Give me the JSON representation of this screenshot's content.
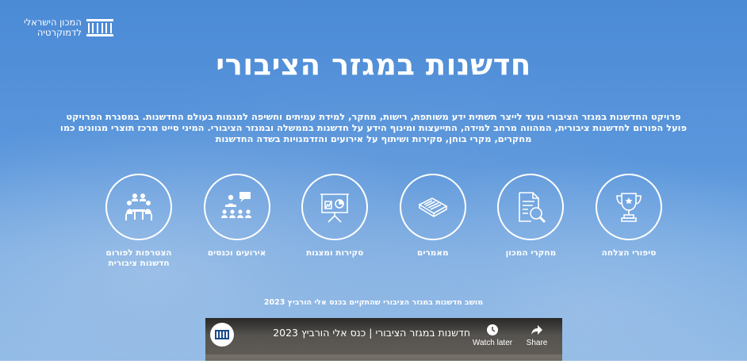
{
  "header": {
    "logo_line1": "המכון הישראלי",
    "logo_line2": "לדמוקרטיה"
  },
  "hero": {
    "title": "חדשנות במגזר הציבורי",
    "intro_line1": "פרויקט החדשנות במגזר הציבורי נועד לייצר תשתית ידע משותפת, רישות, מחקר, למידת עמיתים וחשיפה למגמות בעולם החדשנות. במסגרת הפרויקט",
    "intro_line2": "פועל הפורום לחדשנות ציבורית, המהווה מרחב למידה, התייעצות ומינוף הידע על חדשנות בממשלה ובמגזר הציבורי. המיני סייט מרכז תוצרי מגוונים כמו",
    "intro_line3": "מחקרים, מקרי בוחן, סקירות ושיתוף על אירועים והזדמנויות בשדה החדשנות"
  },
  "features": [
    {
      "label": "סיפורי הצלחה",
      "icon": "trophy-icon"
    },
    {
      "label": "מחקרי המכון",
      "icon": "document-search-icon"
    },
    {
      "label": "מאמרים",
      "icon": "newspaper-icon"
    },
    {
      "label": "סקירות ומצגות",
      "icon": "presentation-icon"
    },
    {
      "label": "אירועים וכנסים",
      "icon": "conference-icon"
    },
    {
      "label": "הצטרפות לפורום חדשנות ציבורית",
      "icon": "meeting-icon"
    }
  ],
  "video": {
    "caption": "מושב חדשנות במגזר הציבורי שהתקיים בכנס אלי הורביץ 2023",
    "title": "חדשנות במגזר הציבורי | כנס אלי הורביץ 2023",
    "watch_later": "Watch later",
    "share": "Share"
  }
}
